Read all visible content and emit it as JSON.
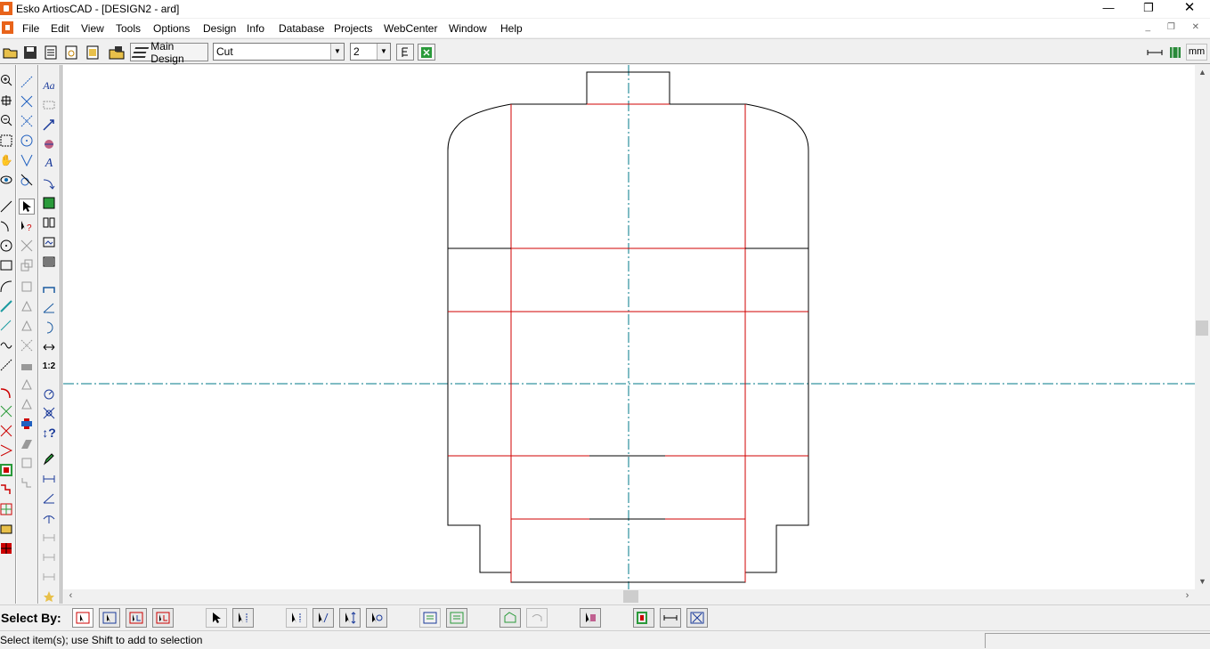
{
  "window": {
    "title": "Esko ArtiosCAD - [DESIGN2 - ard]",
    "minimize_glyph": "—",
    "maximize_glyph": "❐",
    "close_glyph": "✕"
  },
  "menu": {
    "items": [
      "File",
      "Edit",
      "View",
      "Tools",
      "Options",
      "Design",
      "Info",
      "Database",
      "Projects",
      "WebCenter",
      "Window",
      "Help"
    ]
  },
  "toolbar": {
    "main_design_label": "Main Design",
    "line_type_value": "Cut",
    "pointage_value": "2",
    "units_label": "mm"
  },
  "select_by": {
    "label": "Select By:"
  },
  "status": {
    "message": "Select item(s); use Shift to add to selection"
  },
  "colors": {
    "cut_line": "#000000",
    "crease_line": "#d00000",
    "center_line": "#007a8a",
    "accent": "#e8631a"
  },
  "icons": {
    "toolbar": [
      "open-folder-icon",
      "save-icon",
      "properties-icon",
      "print-preview-icon",
      "output-icon",
      "database-icon",
      "layers-icon",
      "pointage-icon",
      "interactive-icon",
      "ruler-icon",
      "map-icon"
    ],
    "tools": [
      "zoom-in-icon",
      "zoom-window-icon",
      "zoom-out-icon",
      "zoom-fit-icon",
      "pan-hand-icon",
      "view-eye-icon",
      "line-tool-icon",
      "arc-tool-icon",
      "circle-tool-icon",
      "rectangle-tool-icon",
      "select-arrow-icon",
      "text-tool-icon",
      "dimension-tool-icon"
    ]
  }
}
